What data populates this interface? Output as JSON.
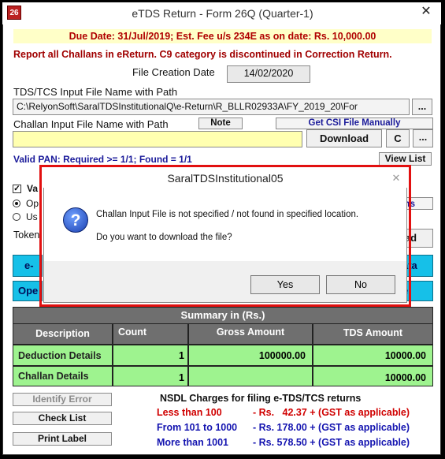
{
  "window": {
    "title": "eTDS Return - Form 26Q (Quarter-1)",
    "icon_text": "26",
    "close_label": "✕"
  },
  "due_banner": "Due Date: 31/Jul/2019; Est. Fee u/s 234E as on date: Rs. 10,000.00",
  "report_notice": "Report all Challans in eReturn.  C9 category is discontinued in Correction Return.",
  "file_creation": {
    "label": "File Creation Date",
    "value": "14/02/2020"
  },
  "tds_input": {
    "label": "TDS/TCS Input File Name with Path",
    "value": "C:\\RelyonSoft\\SaralTDSInstitutionalQ\\e-Return\\R_BLLR02933A\\FY_2019_20\\For",
    "browse_label": "..."
  },
  "challan_input": {
    "label": "Challan Input File Name with Path",
    "note_label": "Note",
    "csi_label": "Get CSI File Manually",
    "value": "",
    "download_label": "Download",
    "c_label": "C",
    "browse_label": "..."
  },
  "pan_status": "Valid PAN: Required >= 1/1; Found = 1/1",
  "view_list_label": "View List",
  "partial": {
    "va": "Va",
    "op": "Op",
    "us": "Us",
    "token": "Token",
    "ns": "ns",
    "oad": "oad",
    "e": "e-",
    "ata": "ata",
    "ope": "Ope",
    "e2": "e"
  },
  "summary": {
    "title": "Summary in (Rs.)",
    "headers": [
      "Description",
      "Count",
      "Gross Amount",
      "TDS Amount"
    ],
    "rows": [
      {
        "desc": "Deduction Details",
        "count": "1",
        "gross": "100000.00",
        "tds": "10000.00"
      },
      {
        "desc": "Challan Details",
        "count": "1",
        "gross": "",
        "tds": "10000.00"
      }
    ]
  },
  "side_buttons": {
    "identify": "Identify Error",
    "checklist": "Check List",
    "print": "Print Label"
  },
  "nsdl": {
    "title": "NSDL Charges for filing e-TDS/TCS returns",
    "lines": [
      {
        "range": "Less than 100",
        "charge": "- Rs.   42.37 + (GST as applicable)"
      },
      {
        "range": "From 101 to 1000",
        "charge": "- Rs. 178.00 + (GST as applicable)"
      },
      {
        "range": "More than 1001",
        "charge": "- Rs. 578.50 + (GST as applicable)"
      }
    ]
  },
  "dialog": {
    "title": "SaralTDSInstitutional05",
    "message": "Challan Input File is not specified / not found in specified location.",
    "question": "Do you want to download the file?",
    "yes_label": "Yes",
    "no_label": "No",
    "icon_glyph": "?"
  },
  "colors": {
    "dialog_highlight": "#e21010",
    "due_banner_bg": "#ffffc8",
    "table_row_bg": "#9ef38f",
    "cyan_button": "#16c0e8"
  }
}
